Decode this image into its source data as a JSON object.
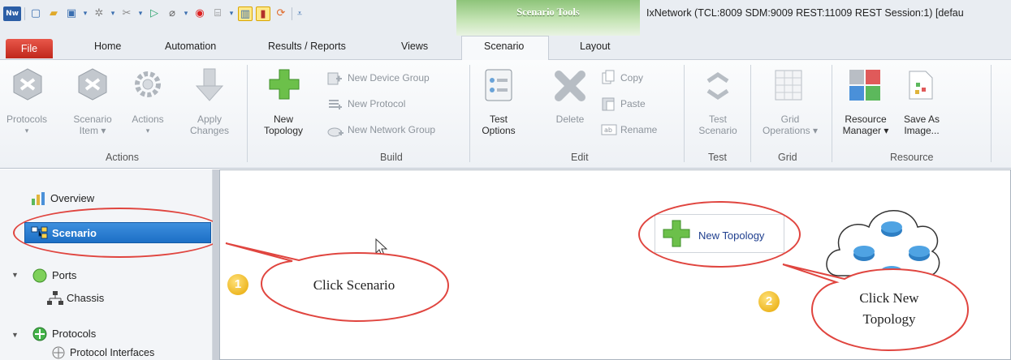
{
  "quick_access": {
    "app_badge": "Nw"
  },
  "title_bar": {
    "context_group": "Scenario Tools",
    "window_title": "IxNetwork (TCL:8009 SDM:9009 REST:11009 REST Session:1) [defau"
  },
  "tabs": {
    "file": "File",
    "home": "Home",
    "automation": "Automation",
    "results": "Results / Reports",
    "views": "Views",
    "scenario": "Scenario",
    "layout": "Layout"
  },
  "ribbon": {
    "actions": {
      "label": "Actions",
      "protocols": "Protocols",
      "scenario_item": [
        "Scenario",
        "Item ▾"
      ],
      "actions_btn": "Actions",
      "apply_changes": [
        "Apply",
        "Changes"
      ]
    },
    "build": {
      "label": "Build",
      "new_topology": [
        "New",
        "Topology"
      ],
      "new_device_group": "New Device Group",
      "new_protocol": "New Protocol",
      "new_network_group": "New Network Group"
    },
    "edit": {
      "label": "Edit",
      "test_options": [
        "Test",
        "Options"
      ],
      "delete": "Delete",
      "copy": "Copy",
      "paste": "Paste",
      "rename": "Rename"
    },
    "test": {
      "label": "Test",
      "test_scenario": [
        "Test",
        "Scenario"
      ]
    },
    "grid": {
      "label": "Grid",
      "grid_operations": [
        "Grid",
        "Operations ▾"
      ]
    },
    "resource": {
      "label": "Resource",
      "resource_manager": [
        "Resource",
        "Manager ▾"
      ],
      "save_as_image": [
        "Save As",
        "Image..."
      ]
    }
  },
  "nav": {
    "overview": "Overview",
    "scenario": "Scenario",
    "ports": "Ports",
    "chassis": "Chassis",
    "protocols": "Protocols",
    "protocol_interfaces": "Protocol Interfaces"
  },
  "canvas": {
    "new_topology_button": "New Topology",
    "callout_1": {
      "number": "1",
      "text": "Click Scenario"
    },
    "callout_2": {
      "number": "2",
      "text": [
        "Click New",
        "Topology"
      ]
    }
  },
  "colors": {
    "accent_blue": "#1c6fc6",
    "file_tab_red": "#c0271b",
    "context_green": "#8ec47a",
    "callout_red": "#e0453f",
    "badge_yellow": "#e6a600"
  }
}
